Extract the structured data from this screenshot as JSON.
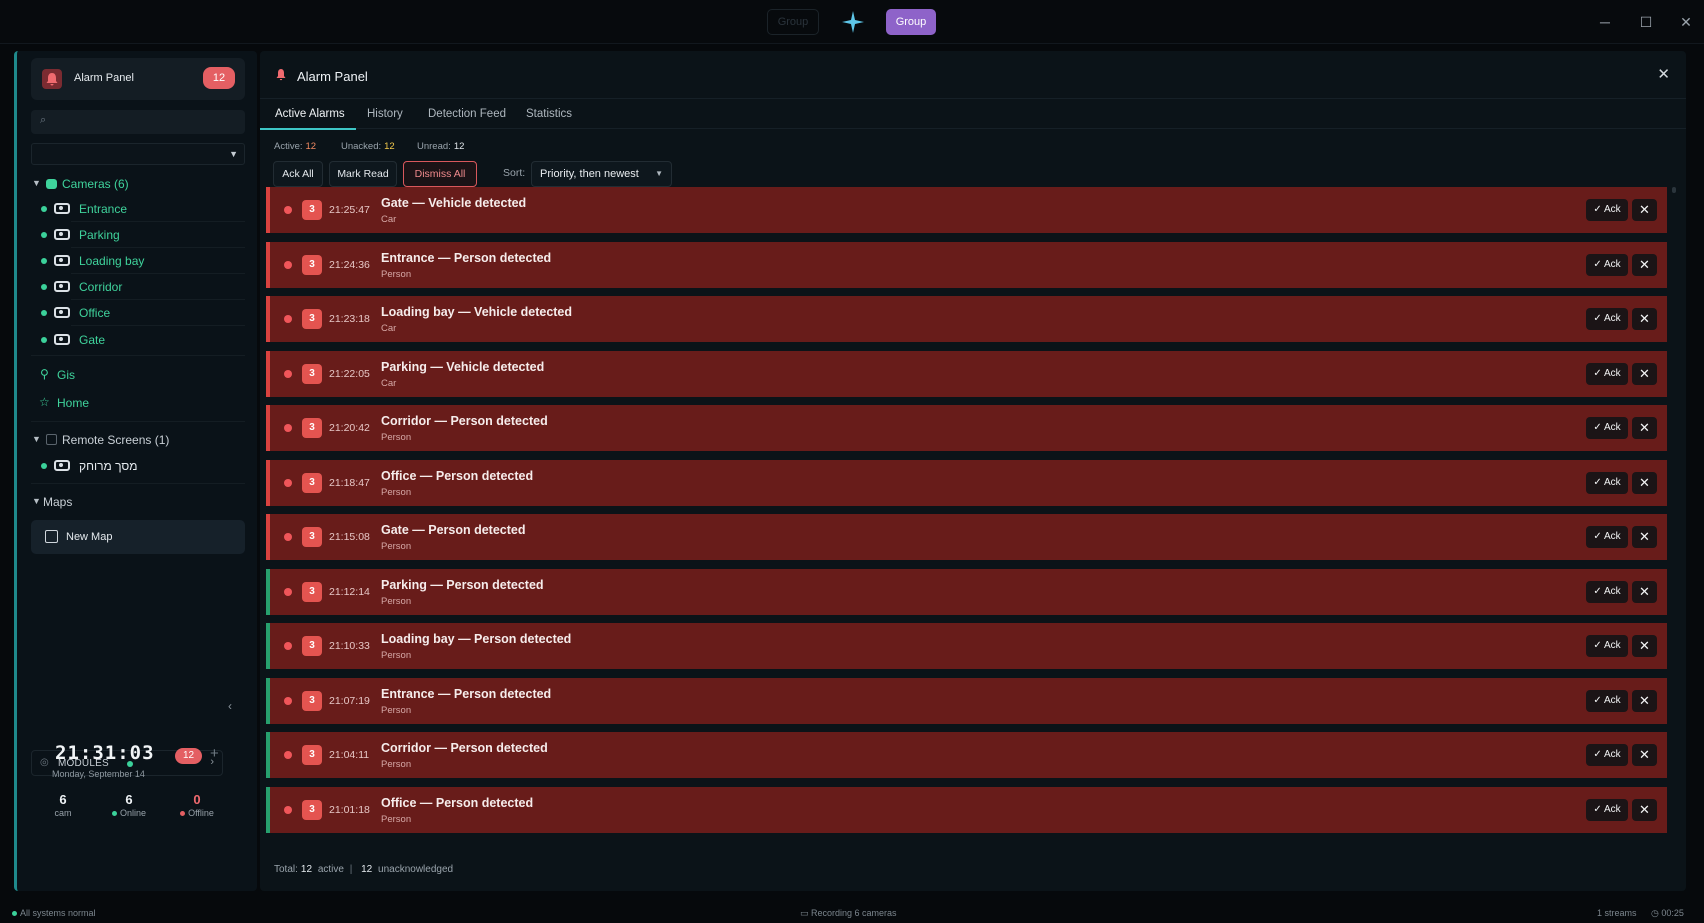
{
  "topbar": {
    "ghost_label": "Group",
    "group_label": "Group",
    "minimize": "─",
    "maximize": "☐",
    "close": "✕"
  },
  "colors": {
    "accent": "#3ec7c6",
    "alarm_row": "#681c1a",
    "alarm_edge": "#d8423f",
    "ok_edge": "#27a06e",
    "badge": "#e45f63",
    "group": "#8e63c9",
    "online": "#3bd19a"
  },
  "sidebar": {
    "title": "Alarm Panel",
    "badge": "12",
    "search_placeholder": "",
    "cameras_label": "Cameras (6)",
    "cameras": [
      "Entrance",
      "Parking",
      "Loading bay",
      "Corridor",
      "Office",
      "Gate"
    ],
    "gis_label": "Gis",
    "home_label": "Home",
    "remote_label": "Remote Screens (1)",
    "remote_items": [
      "מסך מרוחק"
    ],
    "maps_label": "Maps",
    "new_map_label": "New Map",
    "modules_label": "MODULES",
    "clock": "21:31:03",
    "date": "Monday, September 14",
    "clock_badge": "12",
    "stats": [
      {
        "num": "6",
        "label": "cam"
      },
      {
        "num": "6",
        "label": "Online"
      },
      {
        "num": "0",
        "label": "Offline"
      }
    ]
  },
  "panel": {
    "title": "Alarm Panel",
    "tabs": [
      "Active Alarms",
      "History",
      "Detection Feed",
      "Statistics"
    ],
    "counters": [
      {
        "label": "Active:",
        "value": "12"
      },
      {
        "label": "Unacked:",
        "value": "12"
      },
      {
        "label": "Unread:",
        "value": "12"
      }
    ],
    "buttons": {
      "ack_all": "Ack All",
      "mark_read": "Mark Read",
      "dismiss_all": "Dismiss All"
    },
    "sort_label": "Sort:",
    "sort_value": "Priority, then newest",
    "ack_label": "Ack",
    "alarms": [
      {
        "priority": "3",
        "time": "21:25:47",
        "title": "Gate — Vehicle detected",
        "sub": "Car",
        "edge": "red"
      },
      {
        "priority": "3",
        "time": "21:24:36",
        "title": "Entrance — Person detected",
        "sub": "Person",
        "edge": "red"
      },
      {
        "priority": "3",
        "time": "21:23:18",
        "title": "Loading bay — Vehicle detected",
        "sub": "Car",
        "edge": "red"
      },
      {
        "priority": "3",
        "time": "21:22:05",
        "title": "Parking — Vehicle detected",
        "sub": "Car",
        "edge": "red"
      },
      {
        "priority": "3",
        "time": "21:20:42",
        "title": "Corridor — Person detected",
        "sub": "Person",
        "edge": "red"
      },
      {
        "priority": "3",
        "time": "21:18:47",
        "title": "Office — Person detected",
        "sub": "Person",
        "edge": "red"
      },
      {
        "priority": "3",
        "time": "21:15:08",
        "title": "Gate — Person detected",
        "sub": "Person",
        "edge": "red"
      },
      {
        "priority": "3",
        "time": "21:12:14",
        "title": "Parking — Person detected",
        "sub": "Person",
        "edge": "green"
      },
      {
        "priority": "3",
        "time": "21:10:33",
        "title": "Loading bay — Person detected",
        "sub": "Person",
        "edge": "green"
      },
      {
        "priority": "3",
        "time": "21:07:19",
        "title": "Entrance — Person detected",
        "sub": "Person",
        "edge": "green"
      },
      {
        "priority": "3",
        "time": "21:04:11",
        "title": "Corridor — Person detected",
        "sub": "Person",
        "edge": "green"
      },
      {
        "priority": "3",
        "time": "21:01:18",
        "title": "Office — Person detected",
        "sub": "Person",
        "edge": "green"
      }
    ],
    "footer": {
      "total_label": "Total:",
      "total": "12",
      "active_label": "active",
      "sep": "|",
      "unacked": "12",
      "unacked_label": "unacknowledged"
    }
  },
  "statusbar": {
    "left": "All systems normal",
    "center": "Recording 6 cameras",
    "streams": "1 streams",
    "right": "00:25"
  }
}
